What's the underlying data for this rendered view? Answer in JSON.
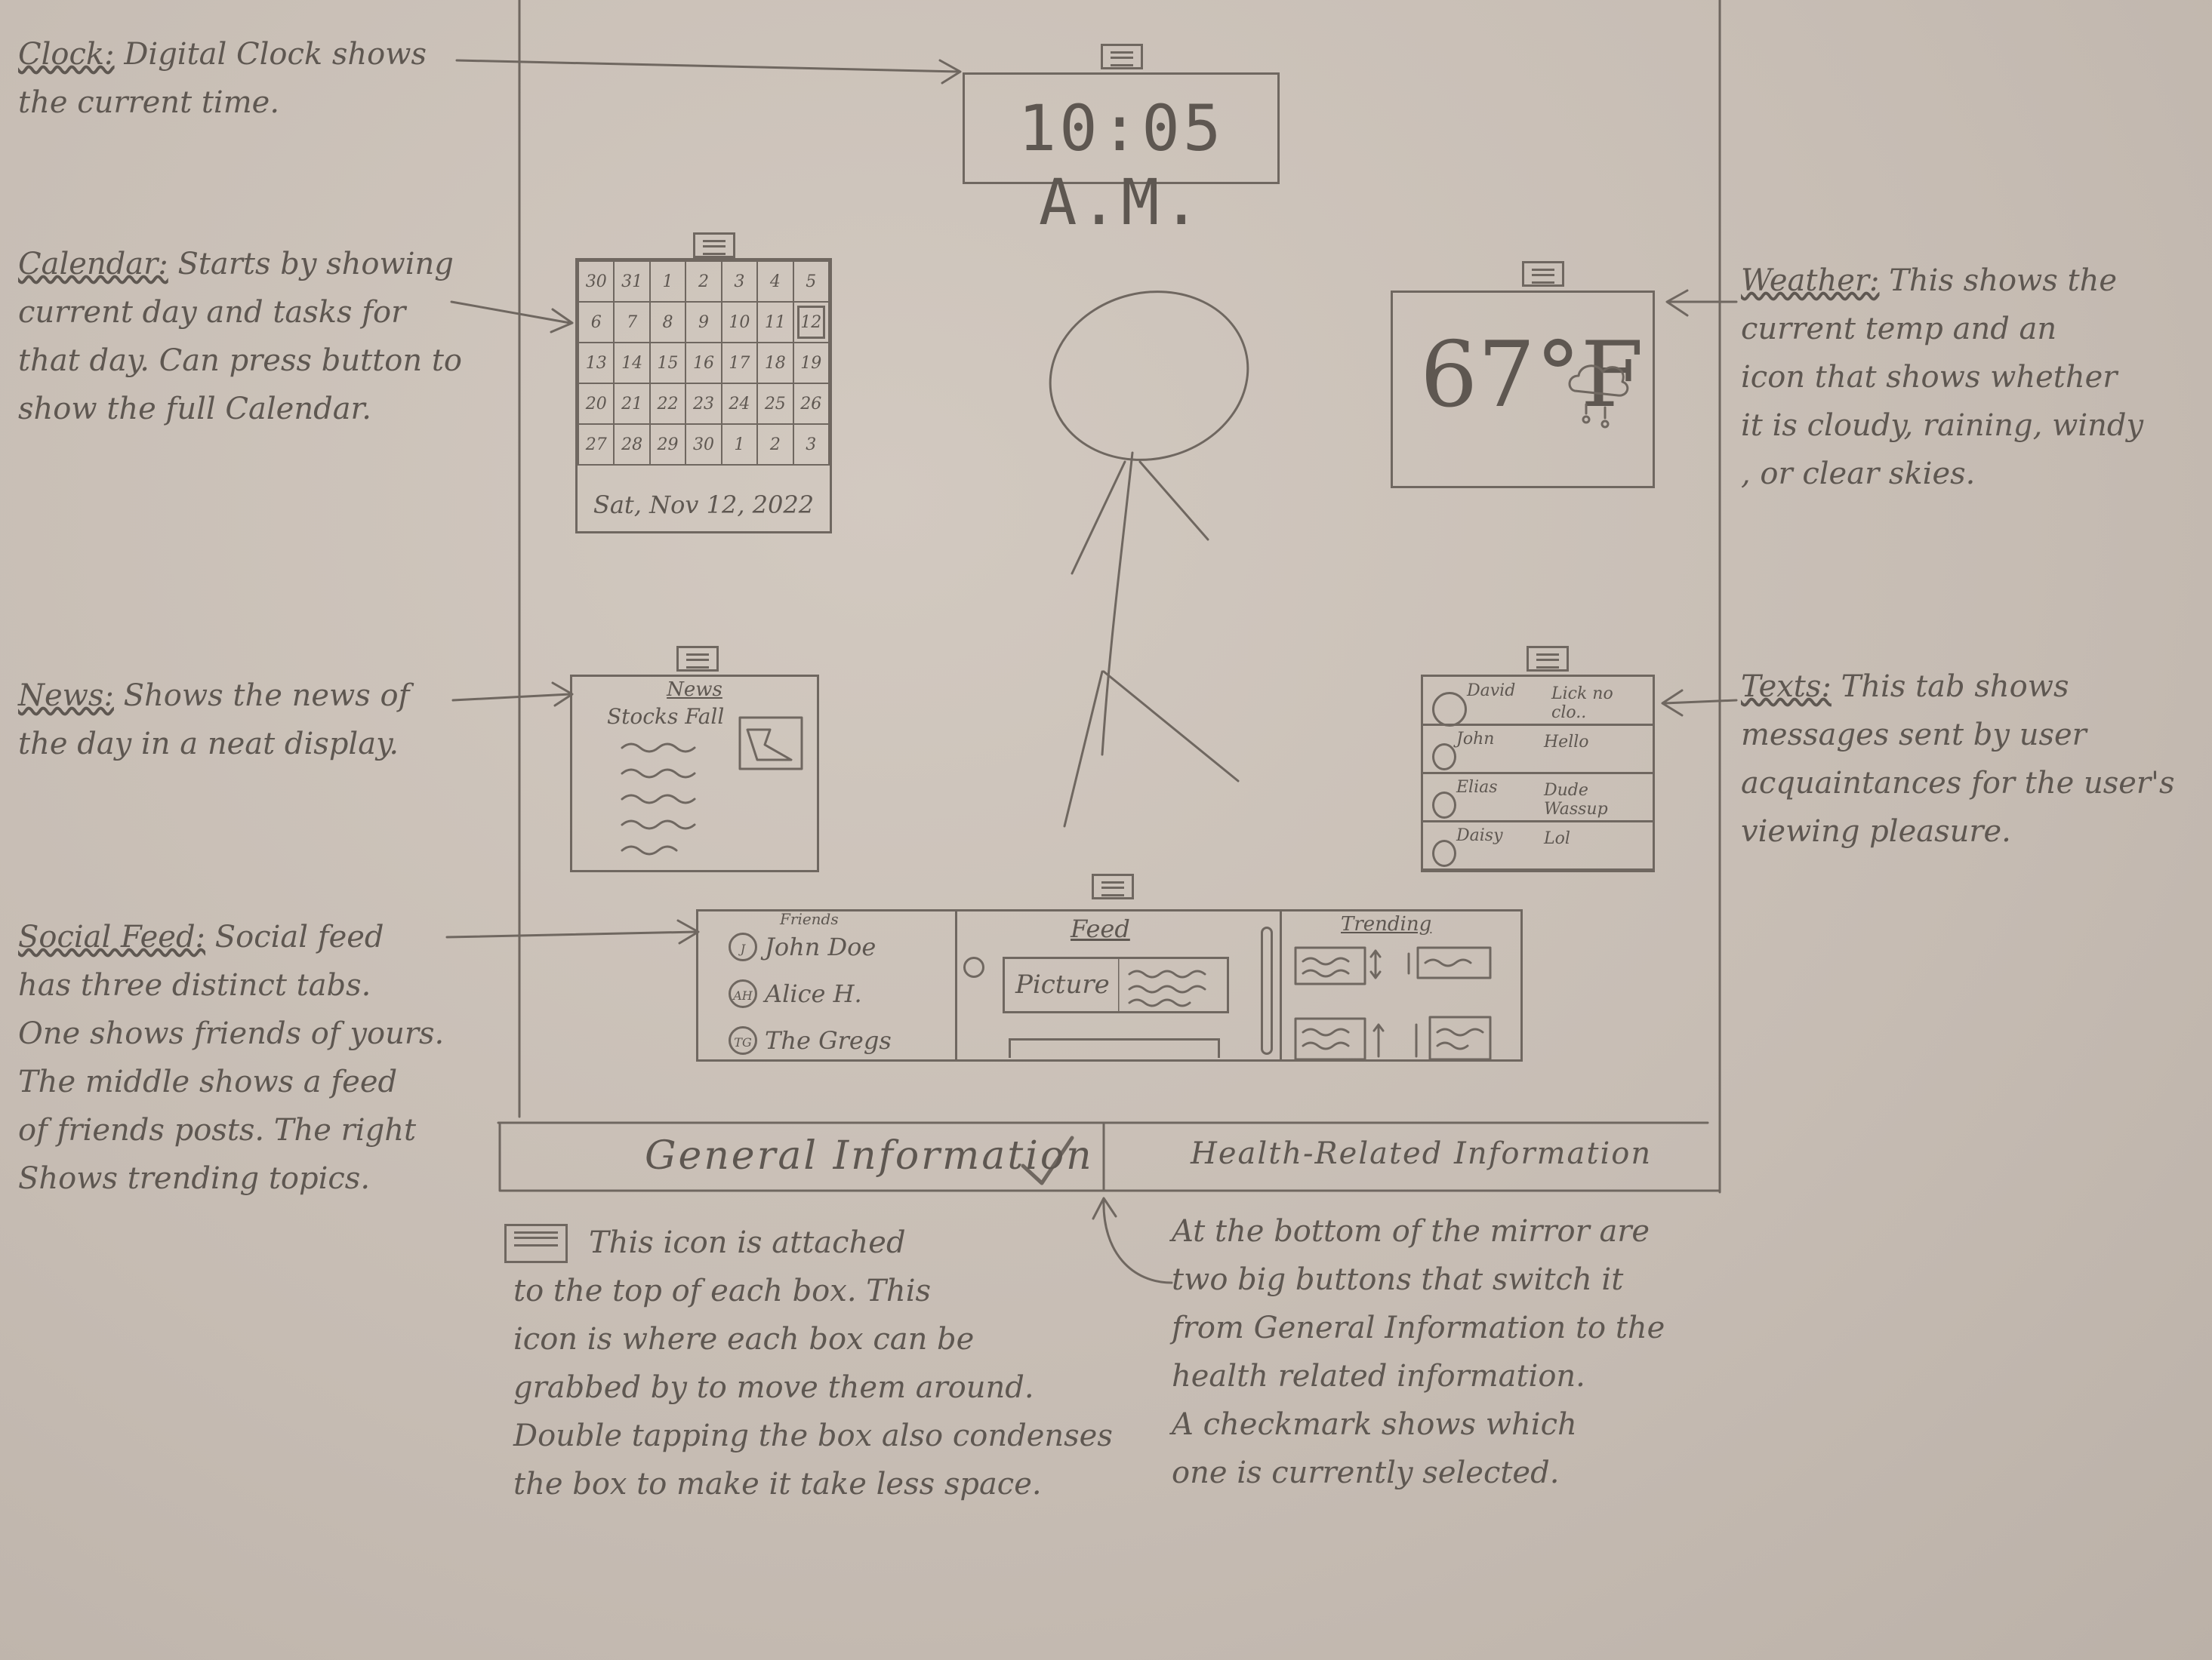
{
  "notes": {
    "clock": {
      "title": "Clock:",
      "text": "Digital Clock shows\nthe current time."
    },
    "calendar": {
      "title": "Calendar:",
      "text": "Starts by showing\ncurrent day and tasks for\nthat day. Can press button to\nshow the full Calendar."
    },
    "news": {
      "title": "News:",
      "text": "Shows the news of\nthe day in a neat display."
    },
    "social": {
      "title": "Social Feed:",
      "text": "Social feed\nhas three distinct tabs.\nOne shows friends of yours.\nThe middle shows a feed\nof friends posts. The right\nShows trending topics."
    },
    "weather": {
      "title": "Weather:",
      "text": "This shows the\ncurrent temp and an\nicon that shows whether\nit is cloudy, raining, windy\n, or clear skies."
    },
    "texts": {
      "title": "Texts:",
      "text": "This tab shows\nmessages sent by user\nacquaintances for the user's\nviewing pleasure."
    },
    "grab_icon": {
      "text": "This icon is attached\nto the top of each box. This\nicon is where each box can be\ngrabbed by to move them around.\nDouble tapping the box also condenses\nthe box to make it take less space."
    },
    "buttons": {
      "text": "At the bottom of the mirror are\ntwo big buttons that switch it\nfrom General Information to the\nhealth related information.\nA checkmark shows which\none is currently selected."
    }
  },
  "clock": {
    "time": "10:05 A.M."
  },
  "calendar": {
    "rows": [
      [
        "30",
        "31",
        "1",
        "2",
        "3",
        "4",
        "5"
      ],
      [
        "6",
        "7",
        "8",
        "9",
        "10",
        "11",
        "12"
      ],
      [
        "13",
        "14",
        "15",
        "16",
        "17",
        "18",
        "19"
      ],
      [
        "20",
        "21",
        "22",
        "23",
        "24",
        "25",
        "26"
      ],
      [
        "27",
        "28",
        "29",
        "30",
        "1",
        "2",
        "3"
      ]
    ],
    "date": "Sat, Nov 12, 2022"
  },
  "weather": {
    "temp": "67°F",
    "icon": "cloud-rain-icon"
  },
  "news": {
    "title": "News",
    "headline": "Stocks Fall",
    "icon": "image-icon"
  },
  "texts": {
    "messages": [
      {
        "name": "David",
        "text": "Lick no clo.."
      },
      {
        "name": "John",
        "text": "Hello"
      },
      {
        "name": "Elias",
        "text": "Dude Wassup"
      },
      {
        "name": "Daisy",
        "text": "Lol"
      }
    ]
  },
  "social": {
    "friends_tab": "Friends",
    "friends": [
      {
        "badge": "J",
        "name": "John Doe"
      },
      {
        "badge": "AH",
        "name": "Alice H."
      },
      {
        "badge": "TG",
        "name": "The Gregs"
      }
    ],
    "feed_tab": "Feed",
    "feed_picture": "Picture",
    "trending_tab": "Trending"
  },
  "bottom_buttons": {
    "general": "General Information",
    "health": "Health-Related Information",
    "selected": "general"
  },
  "colors": {
    "paper": "#c9bfb6",
    "pencil": "#6f6760"
  }
}
